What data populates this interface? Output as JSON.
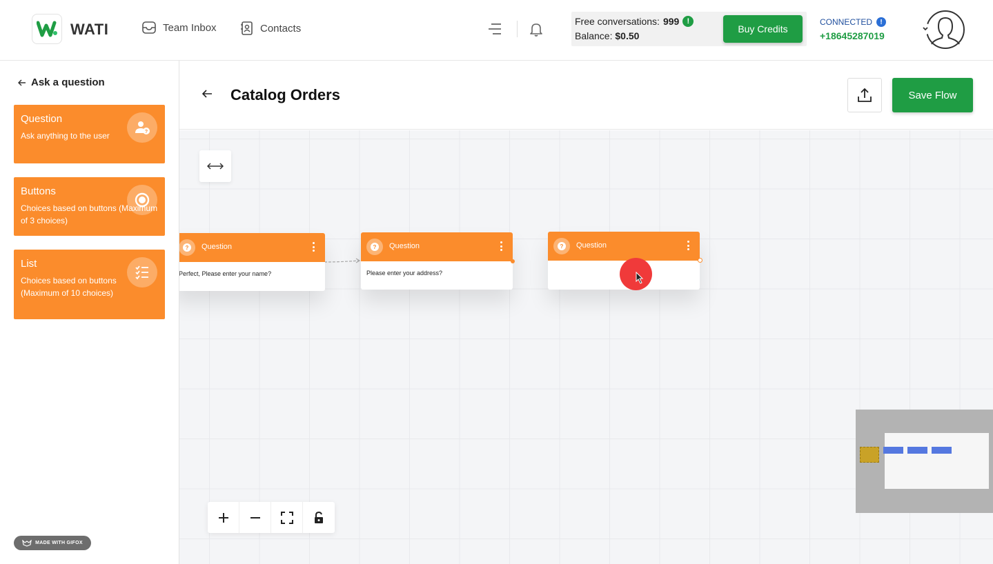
{
  "header": {
    "brand": "WATI",
    "nav": [
      {
        "label": "Team Inbox",
        "icon": "inbox-icon"
      },
      {
        "label": "Contacts",
        "icon": "contacts-icon"
      }
    ],
    "credits": {
      "free_label": "Free conversations:",
      "free_value": "999",
      "balance_label": "Balance:",
      "balance_value": "$0.50",
      "buy_label": "Buy Credits"
    },
    "connection": {
      "status": "CONNECTED",
      "phone": "+18645287019"
    },
    "colors": {
      "brand_green": "#1f9d44",
      "accent_orange": "#fb8c2c",
      "connected_blue": "#1f4e9d"
    }
  },
  "sidebar": {
    "back_label": "Ask a question",
    "cards": [
      {
        "title": "Question",
        "desc": "Ask anything to the user",
        "icon": "user-question-icon"
      },
      {
        "title": "Buttons",
        "desc": "Choices based on buttons (Maximum of 3 choices)",
        "icon": "radio-button-icon"
      },
      {
        "title": "List",
        "desc": "Choices based on buttons (Maximum of 10 choices)",
        "icon": "checklist-icon"
      }
    ],
    "watermark": "MADE WITH GIFOX"
  },
  "flow": {
    "title": "Catalog Orders",
    "save_label": "Save Flow",
    "nodes": [
      {
        "title": "Question",
        "text": "Perfect, Please enter your name?"
      },
      {
        "title": "Question",
        "text": "Please enter your address?"
      },
      {
        "title": "Question",
        "text": ""
      }
    ],
    "controls": [
      "zoom-in",
      "zoom-out",
      "fit-view",
      "lock"
    ]
  }
}
